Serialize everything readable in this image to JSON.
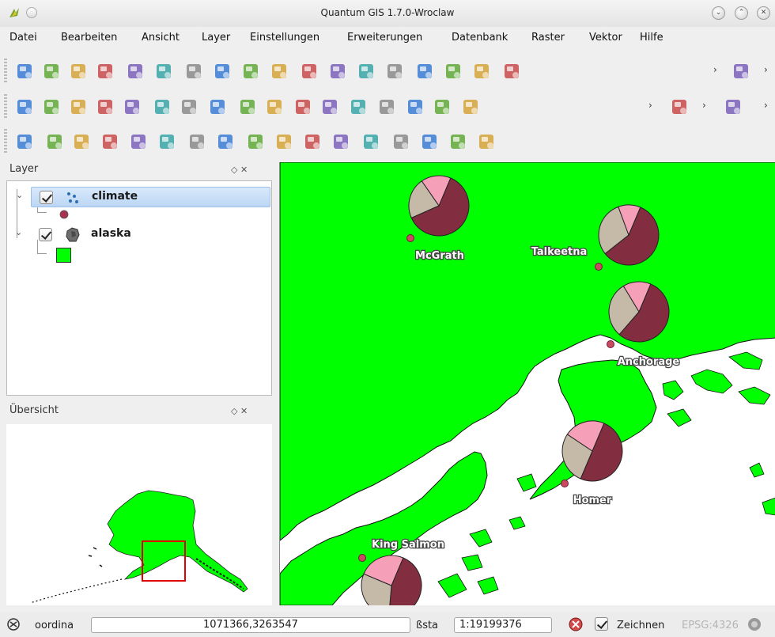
{
  "window": {
    "title": "Quantum GIS 1.7.0-Wroclaw"
  },
  "menu": [
    "Datei",
    "Bearbeiten",
    "Ansicht",
    "Layer",
    "Einstellungen",
    "Erweiterungen",
    "Datenbank",
    "Raster",
    "Vektor",
    "Hilfe"
  ],
  "toolbar1": {
    "icons": [
      "new-project-icon",
      "open-project-icon",
      "save-project-icon",
      "save-as-icon",
      "print-composer-icon",
      "print-icon",
      "add-vector-layer-icon",
      "add-raster-layer-icon",
      "add-postgis-layer-icon",
      "add-spatialite-layer-icon",
      "add-wms-layer-icon",
      "new-layer-icon",
      "remove-layer-icon",
      "add-wfs-layer-icon",
      "identify-icon",
      "select-icon",
      "deselect-icon",
      "attribute-table-icon",
      "plugin-icon"
    ]
  },
  "toolbar2": {
    "icons": [
      "edit-pencil-icon",
      "save-edits-icon",
      "move-feature-icon",
      "node-tool-icon",
      "delete-selected-icon",
      "cut-icon",
      "copy-icon",
      "paste-icon",
      "undo-icon",
      "redo-icon",
      "simplify-icon",
      "add-ring-icon",
      "add-part-icon",
      "delete-ring-icon",
      "delete-part-icon",
      "reshape-icon",
      "split-icon",
      "label-icon",
      "capture-icon"
    ]
  },
  "toolbar3": {
    "icons": [
      "pan-icon",
      "zoom-in-icon",
      "zoom-out-icon",
      "zoom-full-icon",
      "zoom-selection-icon",
      "zoom-layer-icon",
      "zoom-actual-icon",
      "zoom-last-icon",
      "zoom-next-icon",
      "refresh-icon",
      "map-tips-icon",
      "measure-icon",
      "measure-area-icon",
      "histogram-icon",
      "new-bookmark-icon",
      "show-bookmarks-icon",
      "annotation-icon"
    ]
  },
  "layers_panel": {
    "title": "Layer",
    "controls": "◇ ✕",
    "layers": [
      {
        "name": "climate",
        "checked": true,
        "symbol_color": "#a83250",
        "selected": true
      },
      {
        "name": "alaska",
        "checked": true,
        "symbol_color": "#00ff00",
        "selected": false
      }
    ]
  },
  "overview_panel": {
    "title": "Übersicht",
    "controls": "◇ ✕"
  },
  "map": {
    "land_color": "#00ff00",
    "water_color": "#ffffff",
    "pie_colors": [
      "#832e40",
      "#c5b9a8",
      "#f5a0b8"
    ],
    "places": [
      {
        "name": "McGrath",
        "slices": [
          62,
          22,
          16
        ]
      },
      {
        "name": "Talkeetna",
        "slices": [
          58,
          30,
          12
        ]
      },
      {
        "name": "Anchorage",
        "slices": [
          55,
          30,
          15
        ]
      },
      {
        "name": "Homer",
        "slices": [
          50,
          28,
          22
        ]
      },
      {
        "name": "King Salmon",
        "slices": [
          45,
          30,
          25
        ]
      }
    ]
  },
  "status": {
    "coords_label": "oordina",
    "coords_value": "1071366,3263547",
    "scale_label": "ßsta",
    "scale_value": "1:19199376",
    "render_label": "Zeichnen",
    "crs_label": "EPSG:4326",
    "render_checked": true
  }
}
